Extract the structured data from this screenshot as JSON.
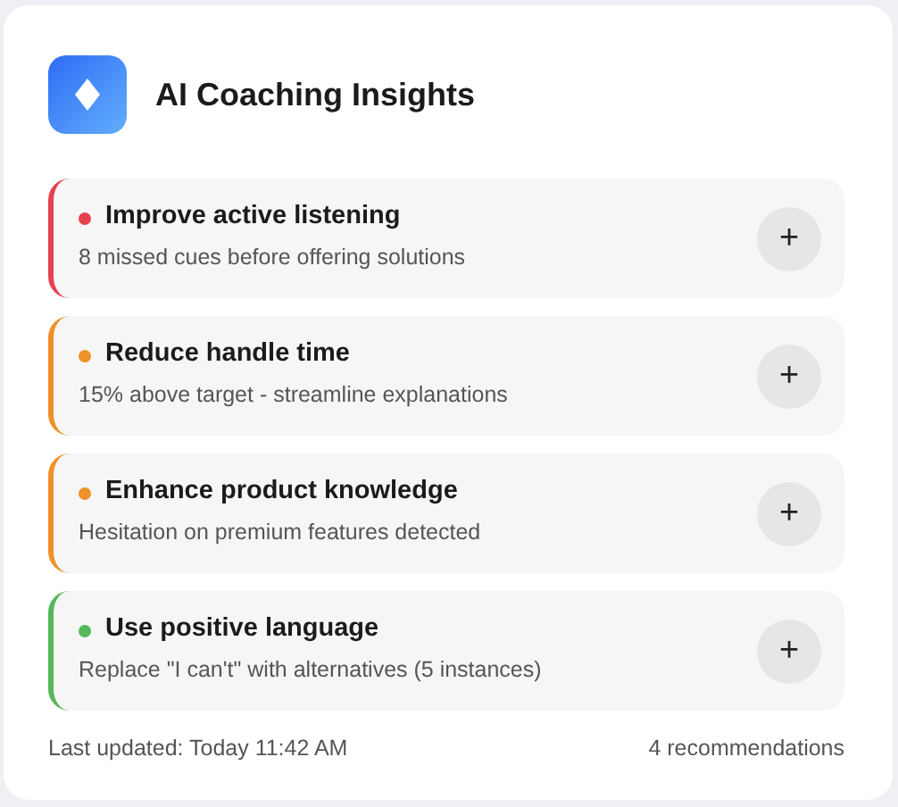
{
  "header": {
    "title": "AI Coaching Insights"
  },
  "recommendations": [
    {
      "title": "Improve active listening",
      "detail": "8 missed cues before offering solutions",
      "color": "#e8414f",
      "action": "+"
    },
    {
      "title": "Reduce handle time",
      "detail": "15% above target - streamline explanations",
      "color": "#f0902a",
      "action": "+"
    },
    {
      "title": "Enhance product knowledge",
      "detail": "Hesitation on premium features detected",
      "color": "#f0902a",
      "action": "+"
    },
    {
      "title": "Use positive language",
      "detail": "Replace \"I can't\" with alternatives (5 instances)",
      "color": "#55b85a",
      "action": "+"
    }
  ],
  "footer": {
    "updated": "Last updated: Today 11:42 AM",
    "count": "4 recommendations"
  }
}
